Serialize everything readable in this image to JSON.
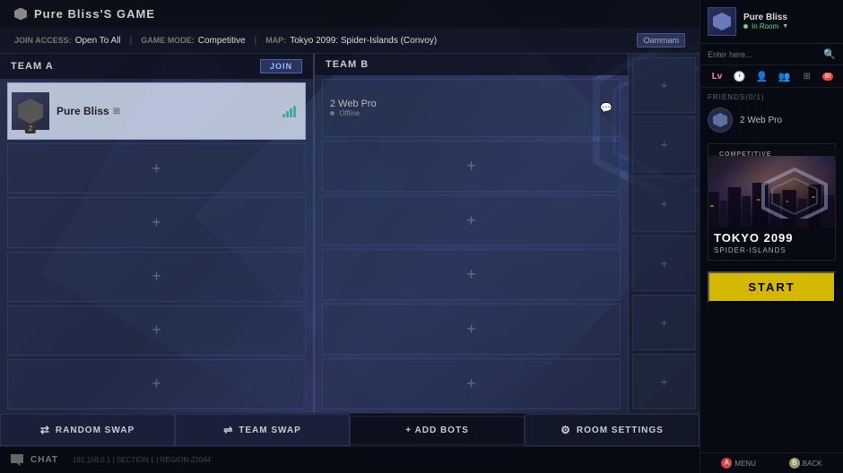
{
  "title": "Pure Bliss'S GAME",
  "info_bar": {
    "join_access_label": "JOIN ACCESS:",
    "join_access_value": "Open To All",
    "separator1": "|",
    "game_mode_label": "GAME MODE:",
    "game_mode_value": "Competitive",
    "separator2": "|",
    "map_label": "MAP:",
    "map_value": "Tokyo 2099: Spider-Islands (Convoy)",
    "badge": "Oammam"
  },
  "team_a": {
    "label": "TEAM A",
    "join_label": "JOIN",
    "players": [
      {
        "name": "Pure Bliss",
        "platform": "xbox",
        "badge": "2",
        "filled": true
      },
      {
        "name": "",
        "filled": false
      },
      {
        "name": "",
        "filled": false
      },
      {
        "name": "",
        "filled": false
      },
      {
        "name": "",
        "filled": false
      },
      {
        "name": "",
        "filled": false
      }
    ]
  },
  "team_b": {
    "label": "TEAM B",
    "players": [
      {
        "name": "2 Web Pro",
        "status": "Offline",
        "filled": true
      },
      {
        "name": "",
        "filled": false
      },
      {
        "name": "",
        "filled": false
      },
      {
        "name": "",
        "filled": false
      },
      {
        "name": "",
        "filled": false
      },
      {
        "name": "",
        "filled": false
      }
    ]
  },
  "spectator_slots": 6,
  "buttons": {
    "random_swap": "RANDOM SWAP",
    "team_swap": "TEAM SWAP",
    "add_bots": "+ ADD BOTS",
    "room_settings": "ROOM SETTINGS",
    "start": "START"
  },
  "footer": {
    "chat_label": "CHAT",
    "info": "192.168.0.1 | SECTION 1 | REGION-22044"
  },
  "sidebar": {
    "username": "Pure Bliss",
    "status": "In Room",
    "search_placeholder": "Enter here...",
    "friends_label": "FRIENDS(0/1)",
    "friend_name": "2 Web Pro",
    "map_section_label": "COMPETITIVE",
    "map_name": "TOKYO 2099",
    "map_subname": "SPIDER-ISLANDS",
    "start_label": "START",
    "bottom_menu": "MENU",
    "bottom_back": "BACK"
  }
}
